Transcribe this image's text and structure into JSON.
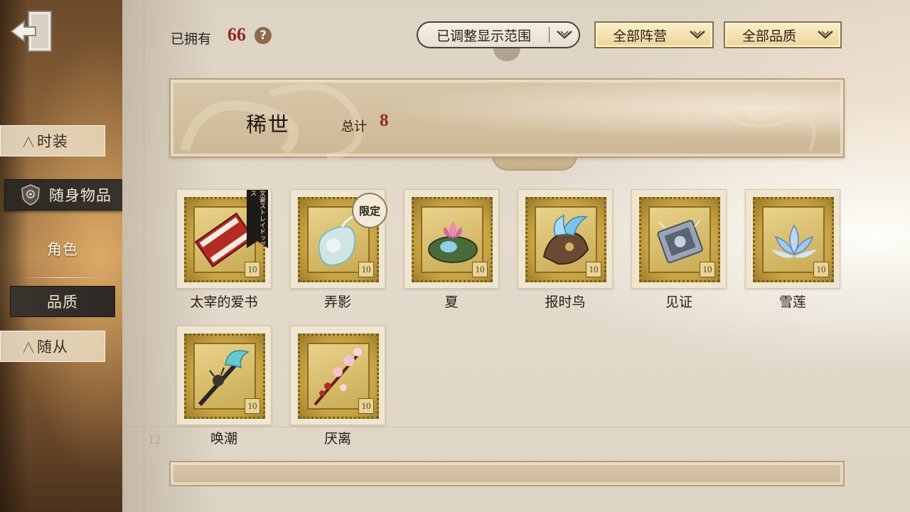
{
  "sidebar": {
    "items": [
      {
        "label": "时装"
      },
      {
        "label": "随身物品"
      },
      {
        "label": "角色"
      },
      {
        "label": "品质"
      },
      {
        "label": "随从"
      }
    ]
  },
  "header": {
    "owned_label": "已拥有",
    "owned_count": "66",
    "help_symbol": "?",
    "filters": {
      "range": "已调整显示范围",
      "camp": "全部阵营",
      "quality": "全部品质"
    }
  },
  "category": {
    "title": "稀世",
    "total_label": "总计",
    "total_value": "8"
  },
  "items": [
    {
      "name": "太宰的爱书",
      "stamp_no": "10",
      "ribbon": "文豪ストレイドッグス",
      "icon": "red-book-icon"
    },
    {
      "name": "弄影",
      "stamp_no": "10",
      "tag": "限定",
      "icon": "crystal-gourd-icon"
    },
    {
      "name": "夏",
      "stamp_no": "10",
      "icon": "lotus-pond-icon"
    },
    {
      "name": "报时鸟",
      "stamp_no": "10",
      "icon": "mechanical-bird-icon"
    },
    {
      "name": "见证",
      "stamp_no": "10",
      "icon": "silver-relic-icon"
    },
    {
      "name": "雪莲",
      "stamp_no": "10",
      "icon": "snow-lotus-icon"
    },
    {
      "name": "唤潮",
      "stamp_no": "10",
      "icon": "tide-staff-icon"
    },
    {
      "name": "厌离",
      "stamp_no": "10",
      "icon": "blossom-branch-icon"
    }
  ],
  "page_mark": "12",
  "colors": {
    "accent_red": "#8e2c22",
    "selected_nav": "#2c2824",
    "stamp_gold": "#c4a040"
  }
}
